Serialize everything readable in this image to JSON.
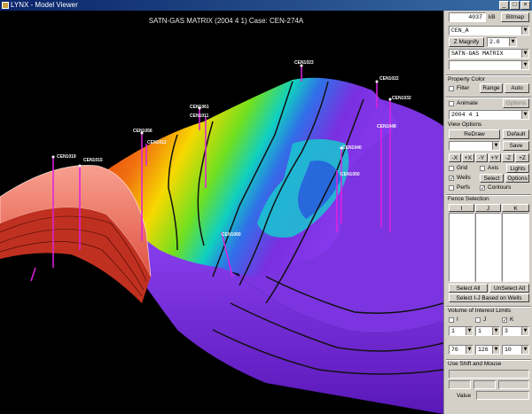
{
  "window": {
    "title": "LYNX - Model Viewer",
    "min": "_",
    "max": "□",
    "close": "×"
  },
  "viewport": {
    "title": "SATN-GAS MATRIX (2004  4  1) Case: CEN-274A",
    "wells": [
      "CEN1023",
      "CEN1022",
      "CEN1032",
      "CEN1061",
      "CEN1011",
      "CEN1048",
      "CEN1056",
      "CEN1012",
      "CEN1040",
      "CEN1019",
      "CEN1015",
      "CEN1050",
      "CEN1060"
    ]
  },
  "panel": {
    "memory_value": "4037",
    "memory_unit": "kB",
    "bitmap": "Bitmap",
    "grid_select": "CEN_A",
    "zmag_label": "Z Magnify",
    "zmag_value": "2.0",
    "property_select": "SATN-GAS MATRIX",
    "blank_select": "",
    "property_color": {
      "heading": "Property Color",
      "filter": "Filter",
      "range": "Range",
      "auto": "Auto"
    },
    "animate": "Animate",
    "options": "Options",
    "date_value": "2004   4    1",
    "view_options": {
      "heading": "View Options",
      "redraw": "ReDraw",
      "default": "Default",
      "save": "Save",
      "save_select": ""
    },
    "views": [
      "-X",
      "+X",
      "-Y",
      "+Y",
      "-Z",
      "+Z"
    ],
    "toggles": {
      "grid": "Grid",
      "axis": "Axis",
      "lights": "Lights",
      "wells": "Wells",
      "select": "Select",
      "options2": "Options",
      "perfs": "Perfs",
      "contours": "Contours"
    },
    "fence": {
      "heading": "Fence Selection",
      "cols": [
        "I",
        "J",
        "K"
      ],
      "select_all": "Select All",
      "unselect_all": "UnSelect All",
      "select_ij": "Select I-J Based on Wells"
    },
    "voi": {
      "heading": "Volume of Interest Limits",
      "i": "I",
      "j": "J",
      "k": "K",
      "min_i": "1",
      "min_j": "1",
      "min_k": "3",
      "max_i": "76",
      "max_j": "126",
      "max_k": "10"
    },
    "shift": {
      "heading": "Use Shift and Mouse",
      "value_label": "Value"
    }
  }
}
